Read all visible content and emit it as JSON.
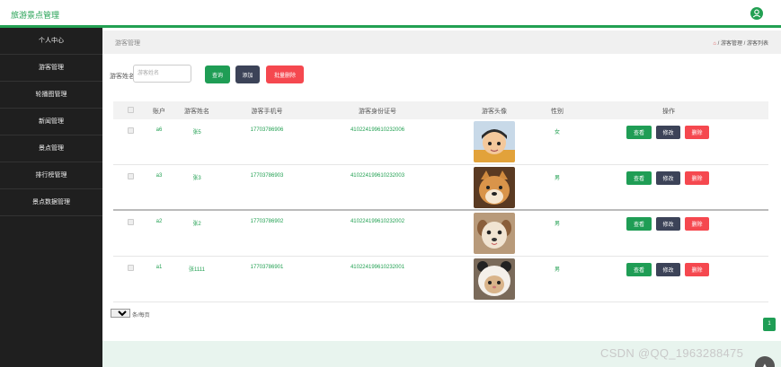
{
  "app": {
    "title": "旅游景点管理"
  },
  "sidebar": {
    "items": [
      {
        "label": "个人中心"
      },
      {
        "label": "游客管理"
      },
      {
        "label": "轮播图管理"
      },
      {
        "label": "新闻管理"
      },
      {
        "label": "景点管理"
      },
      {
        "label": "排行榜管理"
      },
      {
        "label": "景点数据管理"
      }
    ]
  },
  "breadcrumb": {
    "title": "游客管理",
    "path": "/ 游客管理 / 游客列表"
  },
  "search": {
    "label": "游客姓名",
    "placeholder": "游客姓名",
    "search_button": "查询",
    "add_button": "添加",
    "batch_delete_button": "批量删除"
  },
  "table": {
    "headers": [
      "账户",
      "游客姓名",
      "游客手机号",
      "游客身份证号",
      "游客头像",
      "性别",
      "操作"
    ],
    "rows": [
      {
        "account": "a6",
        "name": "张5",
        "phone": "17703786906",
        "idcard": "410224199610232006",
        "gender": "女",
        "avatar": "avatar-cartoon-boy"
      },
      {
        "account": "a3",
        "name": "张3",
        "phone": "17703786903",
        "idcard": "410224199610232003",
        "gender": "男",
        "avatar": "avatar-shiba-dog"
      },
      {
        "account": "a2",
        "name": "张2",
        "phone": "17703786902",
        "idcard": "410224199610232002",
        "gender": "男",
        "avatar": "avatar-puppy"
      },
      {
        "account": "a1",
        "name": "张1111",
        "phone": "17703786901",
        "idcard": "410224199610232001",
        "gender": "男",
        "avatar": "avatar-cat-hood"
      }
    ],
    "actions": {
      "view": "查看",
      "edit": "修改",
      "delete": "删除"
    }
  },
  "pagination": {
    "page_size": "10",
    "page_size_suffix": "条/每页",
    "current_page": "1"
  },
  "watermark": "CSDN @QQ_1963288475",
  "colors": {
    "accent": "#22a052",
    "dark": "#3c4358",
    "danger": "#f5484f",
    "sidebar": "#1f1f1f"
  }
}
